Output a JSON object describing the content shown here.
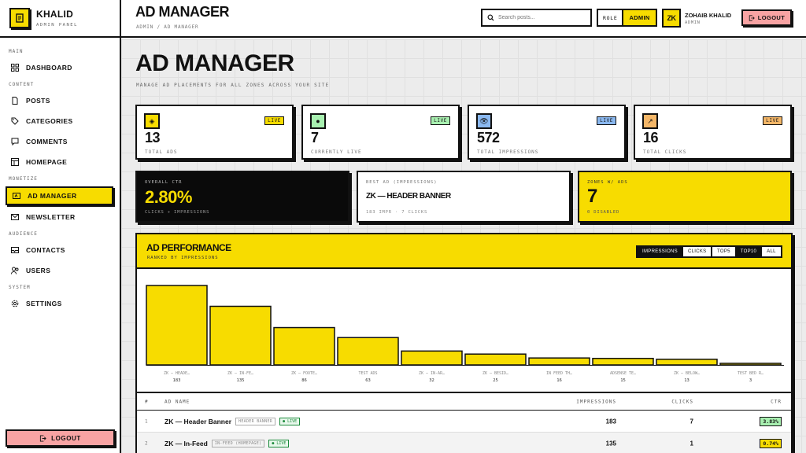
{
  "brand": {
    "name": "KHALID",
    "subtitle": "ADMIN PANEL"
  },
  "nav": {
    "main_label": "MAIN",
    "dashboard": "DASHBOARD",
    "content_label": "CONTENT",
    "posts": "POSTS",
    "categories": "CATEGORIES",
    "comments": "COMMENTS",
    "homepage": "HOMEPAGE",
    "monetize_label": "MONETIZE",
    "ad_manager": "AD MANAGER",
    "newsletter": "NEWSLETTER",
    "audience_label": "AUDIENCE",
    "contacts": "CONTACTS",
    "users": "USERS",
    "system_label": "SYSTEM",
    "settings": "SETTINGS",
    "logout": "LOGOUT"
  },
  "topbar": {
    "title": "AD MANAGER",
    "breadcrumb": "ADMIN / AD MANAGER",
    "search_placeholder": "Search posts...",
    "role_label": "ROLE",
    "role_value": "ADMIN",
    "avatar": "ZK",
    "user_name": "ZOHAIB KHALID",
    "user_role": "ADMIN",
    "logout": "LOGOUT"
  },
  "page": {
    "title": "AD MANAGER",
    "subtitle": "MANAGE AD PLACEMENTS FOR ALL ZONES ACROSS YOUR SITE"
  },
  "stats": [
    {
      "value": "13",
      "label": "TOTAL ADS",
      "badge": "LIVE",
      "icon": "◈",
      "color": "#f7dc00",
      "badge_color": "#f7dc00"
    },
    {
      "value": "7",
      "label": "CURRENTLY LIVE",
      "badge": "LIVE",
      "icon": "●",
      "color": "#a8f0b0",
      "badge_color": "#a8f0b0"
    },
    {
      "value": "572",
      "label": "TOTAL IMPRESSIONS",
      "badge": "LIVE",
      "icon": "👁",
      "color": "#8ab8f0",
      "badge_color": "#8ab8f0"
    },
    {
      "value": "16",
      "label": "TOTAL CLICKS",
      "badge": "LIVE",
      "icon": "↗",
      "color": "#f5b768",
      "badge_color": "#f5b768"
    }
  ],
  "ctr_card": {
    "label": "OVERALL CTR",
    "value": "2.80%",
    "sub": "CLICKS ÷ IMPRESSIONS"
  },
  "best_card": {
    "label": "BEST AD (IMPRESSIONS)",
    "value": "ZK — HEADER BANNER",
    "sub": "183 IMPR · 7 CLICKS"
  },
  "zones_card": {
    "label": "ZONES W/ ADS",
    "value": "7",
    "sub": "0 DISABLED"
  },
  "performance": {
    "title": "AD PERFORMANCE",
    "subtitle": "RANKED BY IMPRESSIONS",
    "metric_options": [
      "IMPRESSIONS",
      "CLICKS"
    ],
    "metric_selected": "IMPRESSIONS",
    "range_options": [
      "TOP5",
      "TOP10",
      "ALL"
    ],
    "range_selected": "TOP10"
  },
  "chart_data": {
    "type": "bar",
    "categories": [
      "ZK — HEADE…",
      "ZK — IN-FE…",
      "ZK — FOOTE…",
      "TEST ADS",
      "ZK — IN-AR…",
      "ZK — BESID…",
      "IN FEED TH…",
      "ADSENSE TE…",
      "ZK — BELOW…",
      "TEST BED R…"
    ],
    "values": [
      183,
      135,
      86,
      63,
      32,
      25,
      16,
      15,
      13,
      3
    ],
    "ylim": [
      0,
      183
    ],
    "color": "#f7dc00"
  },
  "table": {
    "headers": {
      "num": "#",
      "name": "AD NAME",
      "impressions": "IMPRESSIONS",
      "clicks": "CLICKS",
      "ctr": "CTR"
    },
    "rows": [
      {
        "num": "1",
        "name": "ZK — Header Banner",
        "zone": "HEADER BANNER",
        "status": "● LIVE",
        "impressions": "183",
        "clicks": "7",
        "ctr": "3.83%",
        "ctr_color": "#a8f0b0"
      },
      {
        "num": "2",
        "name": "ZK — In-Feed",
        "zone": "IN-FEED (HOMEPAGE)",
        "status": "● LIVE",
        "impressions": "135",
        "clicks": "1",
        "ctr": "0.74%",
        "ctr_color": "#f7dc00"
      }
    ]
  }
}
